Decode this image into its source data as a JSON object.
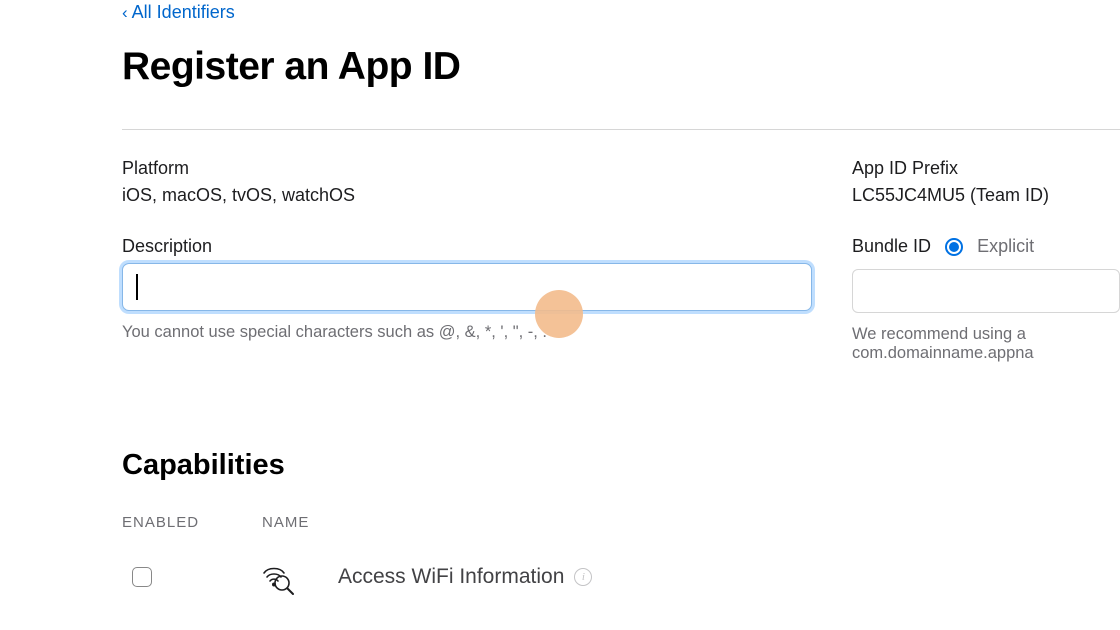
{
  "nav": {
    "back_label": "All Identifiers"
  },
  "header": {
    "title": "Register an App ID"
  },
  "platform": {
    "label": "Platform",
    "value": "iOS, macOS, tvOS, watchOS"
  },
  "prefix": {
    "label": "App ID Prefix",
    "value": "LC55JC4MU5 (Team ID)"
  },
  "description": {
    "label": "Description",
    "value": "",
    "hint": "You cannot use special characters such as @, &, *, ', \", -, ."
  },
  "bundle": {
    "label": "Bundle ID",
    "option_explicit": "Explicit",
    "value": "",
    "hint_line1": "We recommend using a ",
    "hint_line2": "com.domainname.appna"
  },
  "capabilities": {
    "title": "Capabilities",
    "col_enabled": "ENABLED",
    "col_name": "NAME",
    "items": [
      {
        "name": "Access WiFi Information",
        "icon": "wifi-search-icon",
        "enabled": false
      }
    ]
  }
}
